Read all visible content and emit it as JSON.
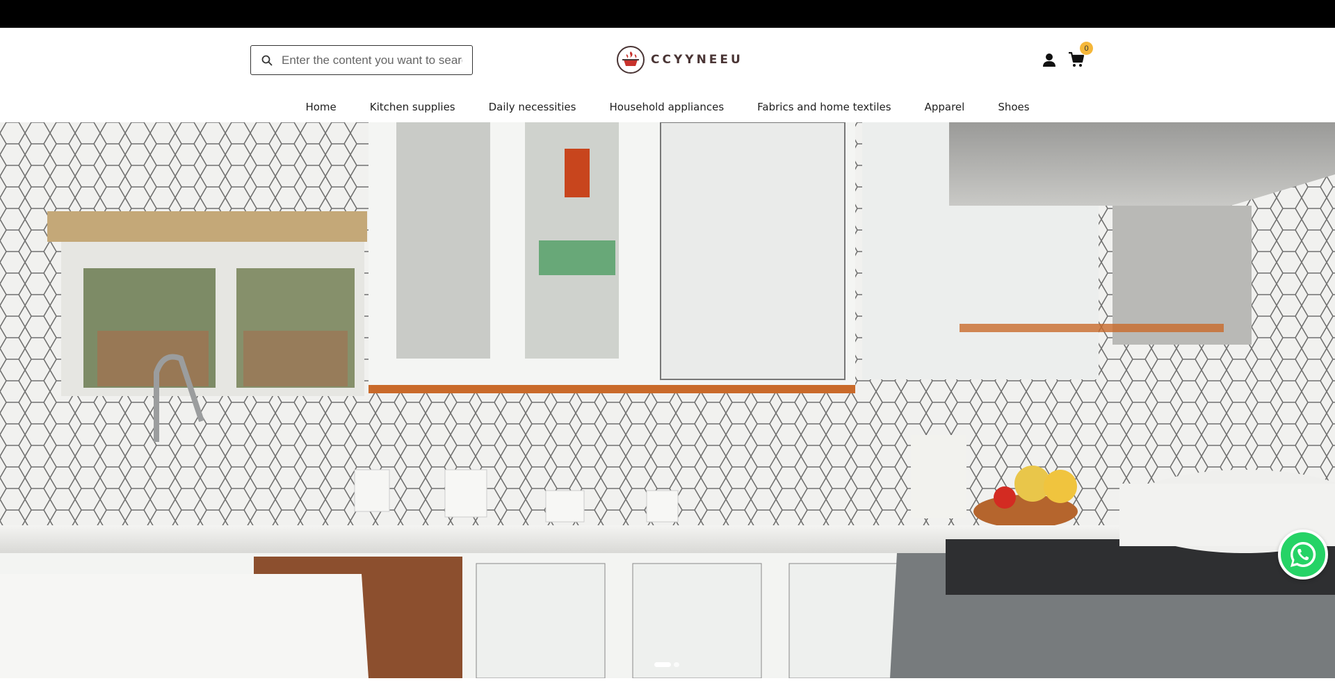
{
  "search": {
    "placeholder": "Enter the content you want to search",
    "value": ""
  },
  "brand": {
    "name": "CCYYNEEU",
    "logo_icon": "pot-flame-logo-icon"
  },
  "cart": {
    "count": "0",
    "badge_color": "#f5b73a"
  },
  "nav": {
    "items": [
      {
        "label": "Home"
      },
      {
        "label": "Kitchen supplies"
      },
      {
        "label": "Daily necessities"
      },
      {
        "label": "Household appliances"
      },
      {
        "label": "Fabrics and home textiles"
      },
      {
        "label": "Apparel"
      },
      {
        "label": "Shoes"
      }
    ]
  },
  "hero": {
    "slides_total": 2,
    "active_slide": 1
  },
  "colors": {
    "topbar": "#000000",
    "whatsapp": "#25d366",
    "accent": "#c8322c"
  },
  "icons": [
    "search-icon",
    "user-icon",
    "cart-icon",
    "whatsapp-icon"
  ]
}
